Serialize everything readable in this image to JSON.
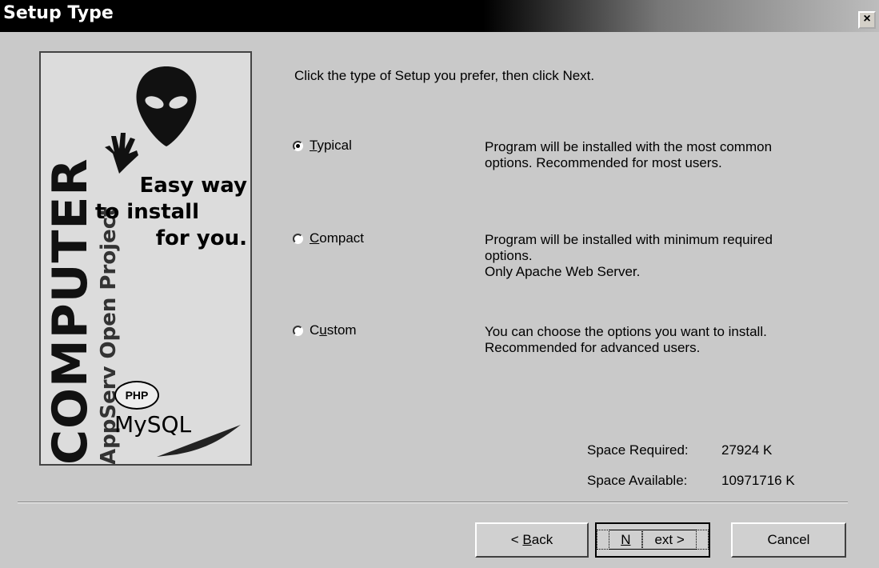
{
  "window": {
    "title": "Setup Type",
    "close_label": "×"
  },
  "banner": {
    "brand": "COMPUTER",
    "project": "AppServ Open Project",
    "tagline_1": "Easy way",
    "tagline_2": "to install",
    "tagline_3": "for you.",
    "php_label": "PHP",
    "mysql_label": "MySQL"
  },
  "prompt": "Click the type of Setup you prefer, then click Next.",
  "options": [
    {
      "key": "T",
      "rest": "ypical",
      "selected": true,
      "desc_1": "Program will be installed with the most common",
      "desc_2": "options. Recommended for most users.",
      "desc_3": ""
    },
    {
      "key": "C",
      "rest": "ompact",
      "selected": false,
      "desc_1": "Program will be installed with minimum required",
      "desc_2": "options.",
      "desc_3": "Only Apache Web Server."
    },
    {
      "pre": "C",
      "key": "u",
      "rest": "stom",
      "selected": false,
      "desc_1": "You can choose the options you want to install.",
      "desc_2": "Recommended for advanced users.",
      "desc_3": ""
    }
  ],
  "space": {
    "required_label": "Space Required:",
    "required_value": "27924 K",
    "available_label": "Space Available:",
    "available_value": "10971716 K"
  },
  "buttons": {
    "back_pre": "< ",
    "back_key": "B",
    "back_rest": "ack",
    "next_key": "N",
    "next_rest": "ext >",
    "cancel": "Cancel"
  }
}
